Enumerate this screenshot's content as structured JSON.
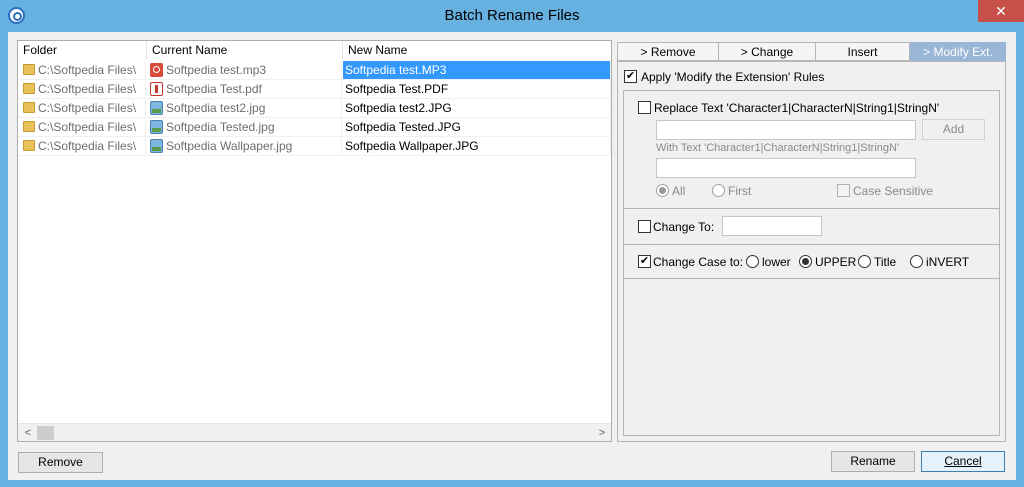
{
  "window": {
    "title": "Batch Rename Files",
    "close_glyph": "✕"
  },
  "list": {
    "columns": [
      "Folder",
      "Current Name",
      "New Name"
    ],
    "rows": [
      {
        "folder": "C:\\Softpedia Files\\",
        "current": "Softpedia test.mp3",
        "new": "Softpedia test.MP3",
        "icon": "mp3-file-icon"
      },
      {
        "folder": "C:\\Softpedia Files\\",
        "current": "Softpedia Test.pdf",
        "new": "Softpedia Test.PDF",
        "icon": "pdf-file-icon"
      },
      {
        "folder": "C:\\Softpedia Files\\",
        "current": "Softpedia test2.jpg",
        "new": "Softpedia test2.JPG",
        "icon": "image-file-icon"
      },
      {
        "folder": "C:\\Softpedia Files\\",
        "current": "Softpedia Tested.jpg",
        "new": "Softpedia Tested.JPG",
        "icon": "image-file-icon"
      },
      {
        "folder": "C:\\Softpedia Files\\",
        "current": "Softpedia Wallpaper.jpg",
        "new": "Softpedia Wallpaper.JPG",
        "icon": "image-file-icon"
      }
    ],
    "scroll_left": "<",
    "scroll_right": ">"
  },
  "tabs": [
    {
      "label": "> Remove"
    },
    {
      "label": "> Change"
    },
    {
      "label": "Insert"
    },
    {
      "label": "> Modify Ext."
    }
  ],
  "options": {
    "apply_label": "Apply 'Modify the Extension' Rules",
    "apply_checked": true,
    "replace_label": "Replace Text  'Character1|CharacterN|String1|StringN'",
    "replace_value": "",
    "add_label": "Add",
    "with_label": "With Text  'Character1|CharacterN|String1|StringN'",
    "with_value": "",
    "all_label": "All",
    "first_label": "First",
    "case_sensitive_label": "Case Sensitive",
    "change_to_label": "Change To:",
    "change_to_value": "",
    "change_case_label": "Change Case to:",
    "change_case_checked": true,
    "case_options": [
      "lower",
      "UPPER",
      "Title",
      "iNVERT"
    ],
    "case_selected": "UPPER"
  },
  "buttons": {
    "remove": "Remove",
    "rename": "Rename",
    "cancel": "Cancel"
  },
  "colors": {
    "title_bar": "#67b1e0",
    "selection": "#3399ff",
    "active_tab": "#9ab6d6",
    "close": "#c7504b"
  }
}
